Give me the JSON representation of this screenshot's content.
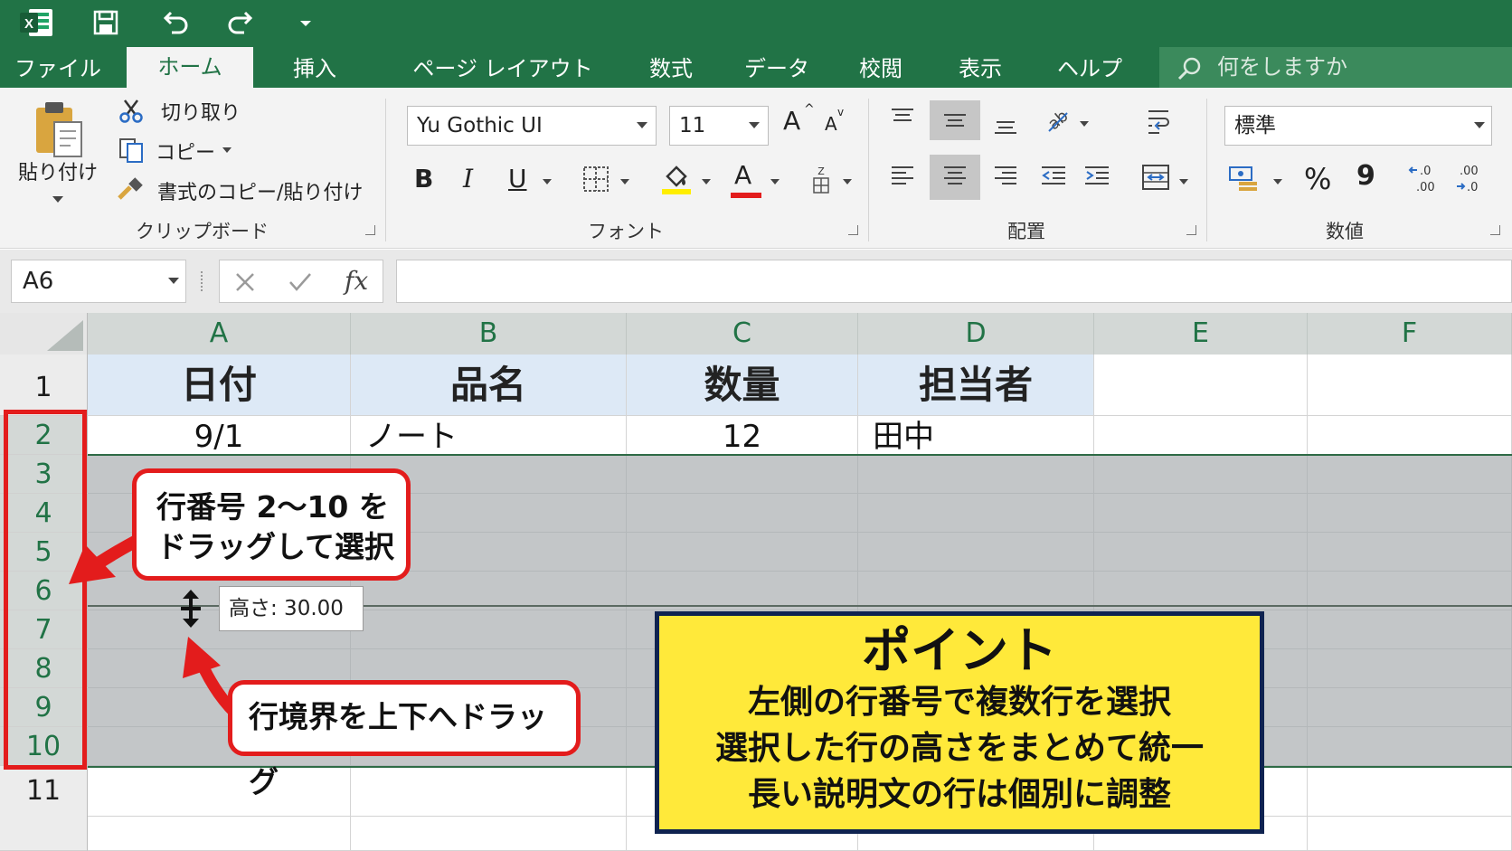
{
  "ribbon_tabs": {
    "file": "ファイル",
    "home": "ホーム",
    "insert": "挿入",
    "page_layout": "ページ レイアウト",
    "formulas": "数式",
    "data": "データ",
    "review": "校閲",
    "view": "表示",
    "help": "ヘルプ"
  },
  "tell_me": "何をしますか",
  "clipboard": {
    "paste": "貼り付け",
    "cut": "切り取り",
    "copy": "コピー",
    "format_painter": "書式のコピー/貼り付け",
    "group_label": "クリップボード"
  },
  "font": {
    "font_name": "Yu Gothic UI",
    "font_size": "11",
    "bold": "B",
    "italic": "I",
    "underline": "U",
    "grow": "A",
    "shrink": "A",
    "font_color": "A",
    "group_label": "フォント"
  },
  "alignment": {
    "group_label": "配置"
  },
  "number": {
    "format": "標準",
    "percent": "%",
    "comma": "9",
    "group_label": "数値"
  },
  "formula_bar": {
    "name_box": "A6",
    "fx": "fx",
    "formula": ""
  },
  "grid": {
    "columns": [
      "A",
      "B",
      "C",
      "D",
      "E",
      "F"
    ],
    "rows": [
      "1",
      "2",
      "3",
      "4",
      "5",
      "6",
      "7",
      "8",
      "9",
      "10",
      "11"
    ],
    "header_row": [
      "日付",
      "品名",
      "数量",
      "担当者"
    ],
    "data_row": [
      "9/1",
      "ノート",
      "12",
      "田中"
    ]
  },
  "annotations": {
    "row_select_line1": "行番号 2〜10 を",
    "row_select_line2": "ドラッグして選択",
    "drag_boundary": "行境界を上下へドラッグ",
    "height_tooltip": "高さ: 30.00",
    "point_title": "ポイント",
    "point_line1": "左側の行番号で複数行を選択",
    "point_line2": "選択した行の高さをまとめて統一",
    "point_line3": "長い説明文の行は個別に調整"
  },
  "colors": {
    "excel_green": "#217346",
    "selection_header": "#d3d8d6",
    "header_fill": "#dde9f6",
    "annotation_red": "#e31c1c",
    "point_yellow": "#ffe93a",
    "point_border": "#0f2350"
  }
}
